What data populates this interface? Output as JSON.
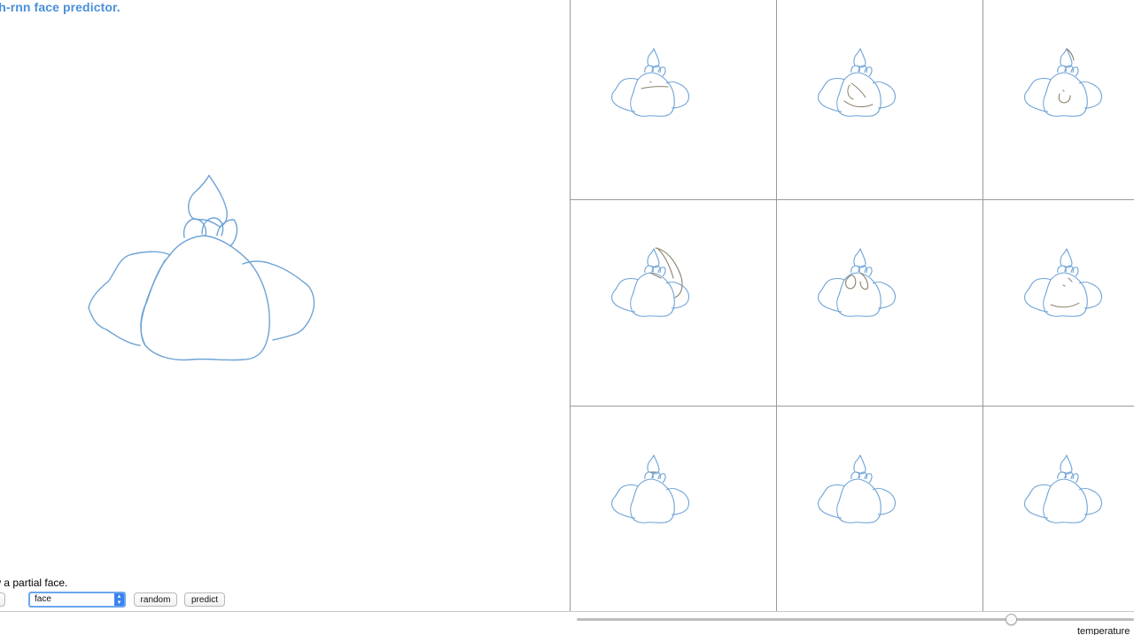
{
  "app": {
    "title": "sketch-rnn face predictor."
  },
  "controls": {
    "instruction": "draw a partial face.",
    "edge_button_label": "",
    "model_selected": "face",
    "random_label": "random",
    "predict_label": "predict"
  },
  "temperature": {
    "label": "temperature",
    "value_fraction": 0.78
  },
  "colors": {
    "title": "#4a90d9",
    "human_stroke": "#6ea3d6",
    "predicted_stroke": "#8a8068",
    "grid_line": "#9a9a9a",
    "select_accent": "#3b82f0"
  },
  "prediction_grid": {
    "rows": 3,
    "columns": 3,
    "cell_count": 9
  }
}
